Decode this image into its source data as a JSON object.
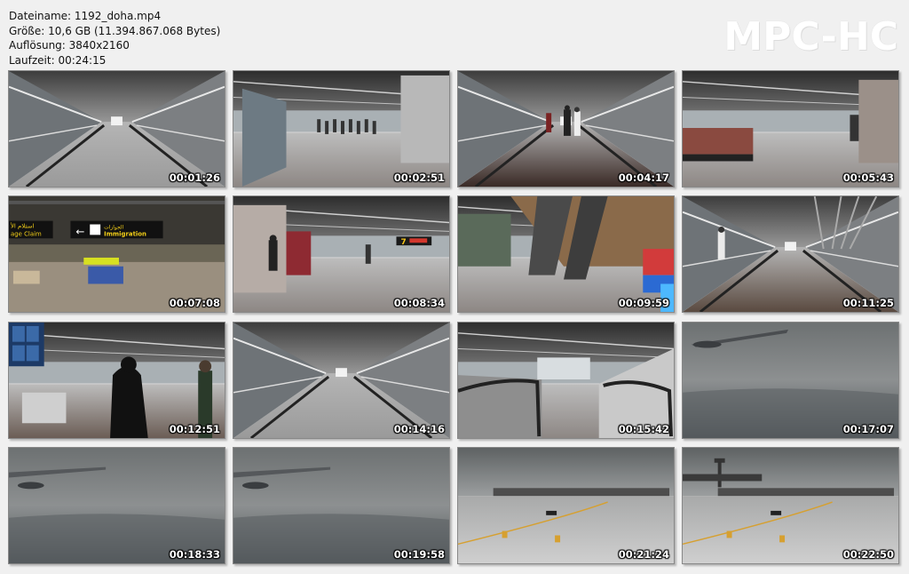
{
  "info": {
    "filename": "Dateiname: 1192_doha.mp4",
    "size": "Größe: 10,6 GB (11.394.867.068 Bytes)",
    "resolution": "Auflösung: 3840x2160",
    "duration": "Laufzeit: 00:24:15"
  },
  "logo": "MPC-HC",
  "thumbnails": [
    {
      "time": "00:01:26",
      "scene": "walkway"
    },
    {
      "time": "00:02:51",
      "scene": "hall"
    },
    {
      "time": "00:04:17",
      "scene": "walkway-people"
    },
    {
      "time": "00:05:43",
      "scene": "hall-seats"
    },
    {
      "time": "00:07:08",
      "scene": "signs",
      "sign_left": "استلام الأ\nage Claim",
      "sign_right": "الجوازات\nImmigration"
    },
    {
      "time": "00:08:34",
      "scene": "hall-gate",
      "gate_number": "7"
    },
    {
      "time": "00:09:59",
      "scene": "atrium"
    },
    {
      "time": "00:11:25",
      "scene": "travelator"
    },
    {
      "time": "00:12:51",
      "scene": "people-hall"
    },
    {
      "time": "00:14:16",
      "scene": "corridor"
    },
    {
      "time": "00:15:42",
      "scene": "escalator"
    },
    {
      "time": "00:17:07",
      "scene": "sky-wing"
    },
    {
      "time": "00:18:33",
      "scene": "sky-wing-low"
    },
    {
      "time": "00:19:58",
      "scene": "sky-wing-low"
    },
    {
      "time": "00:21:24",
      "scene": "apron"
    },
    {
      "time": "00:22:50",
      "scene": "apron-tower"
    }
  ],
  "colors": {
    "background": "#f0f0f0",
    "logo": "#ffffff",
    "timestamp": "#ffffff"
  }
}
